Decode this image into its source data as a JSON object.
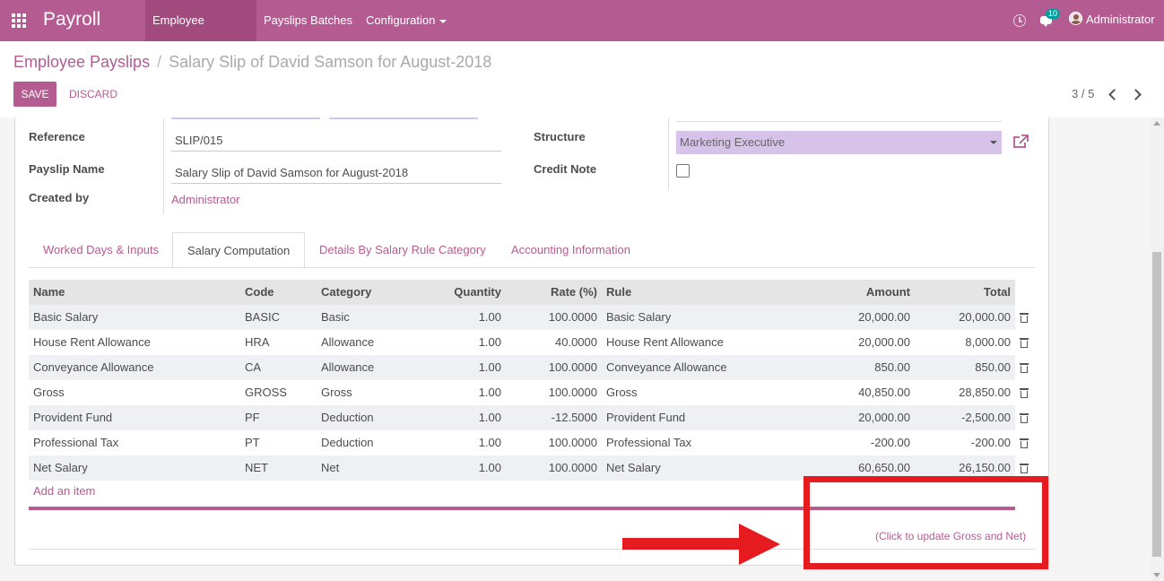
{
  "navbar": {
    "brand": "Payroll",
    "menu": [
      "Employee Payslips",
      "Payslips Batches",
      "Configuration"
    ],
    "notification_count": "10",
    "user": "Administrator"
  },
  "breadcrumb": {
    "parent": "Employee Payslips",
    "separator": "/",
    "current": "Salary Slip of David Samson for August-2018"
  },
  "buttons": {
    "save": "SAVE",
    "discard": "DISCARD"
  },
  "pager": {
    "value": "3 / 5"
  },
  "form": {
    "reference_label": "Reference",
    "reference_value": "SLIP/015",
    "payslip_name_label": "Payslip Name",
    "payslip_name_value": "Salary Slip of David Samson for August-2018",
    "created_by_label": "Created by",
    "created_by_value": "Administrator",
    "structure_label": "Structure",
    "structure_value": "Marketing Executive",
    "credit_note_label": "Credit Note"
  },
  "tabs": [
    "Worked Days & Inputs",
    "Salary Computation",
    "Details By Salary Rule Category",
    "Accounting Information"
  ],
  "table": {
    "headers": [
      "Name",
      "Code",
      "Category",
      "Quantity",
      "Rate (%)",
      "Rule",
      "Amount",
      "Total"
    ],
    "rows": [
      [
        "Basic Salary",
        "BASIC",
        "Basic",
        "1.00",
        "100.0000",
        "Basic Salary",
        "20,000.00",
        "20,000.00"
      ],
      [
        "House Rent Allowance",
        "HRA",
        "Allowance",
        "1.00",
        "40.0000",
        "House Rent Allowance",
        "20,000.00",
        "8,000.00"
      ],
      [
        "Conveyance Allowance",
        "CA",
        "Allowance",
        "1.00",
        "100.0000",
        "Conveyance Allowance",
        "850.00",
        "850.00"
      ],
      [
        "Gross",
        "GROSS",
        "Gross",
        "1.00",
        "100.0000",
        "Gross",
        "40,850.00",
        "28,850.00"
      ],
      [
        "Provident Fund",
        "PF",
        "Deduction",
        "1.00",
        "-12.5000",
        "Provident Fund",
        "20,000.00",
        "-2,500.00"
      ],
      [
        "Professional Tax",
        "PT",
        "Deduction",
        "1.00",
        "100.0000",
        "Professional Tax",
        "-200.00",
        "-200.00"
      ],
      [
        "Net Salary",
        "NET",
        "Net",
        "1.00",
        "100.0000",
        "Net Salary",
        "60,650.00",
        "26,150.00"
      ]
    ],
    "add_item": "Add an item"
  },
  "update_link": "(Click to update Gross and Net)",
  "colors": {
    "primary": "#b45c91",
    "primary_dark": "#a04a7d",
    "select_bg": "#d7c3ea",
    "annotation": "#e51b1f"
  }
}
